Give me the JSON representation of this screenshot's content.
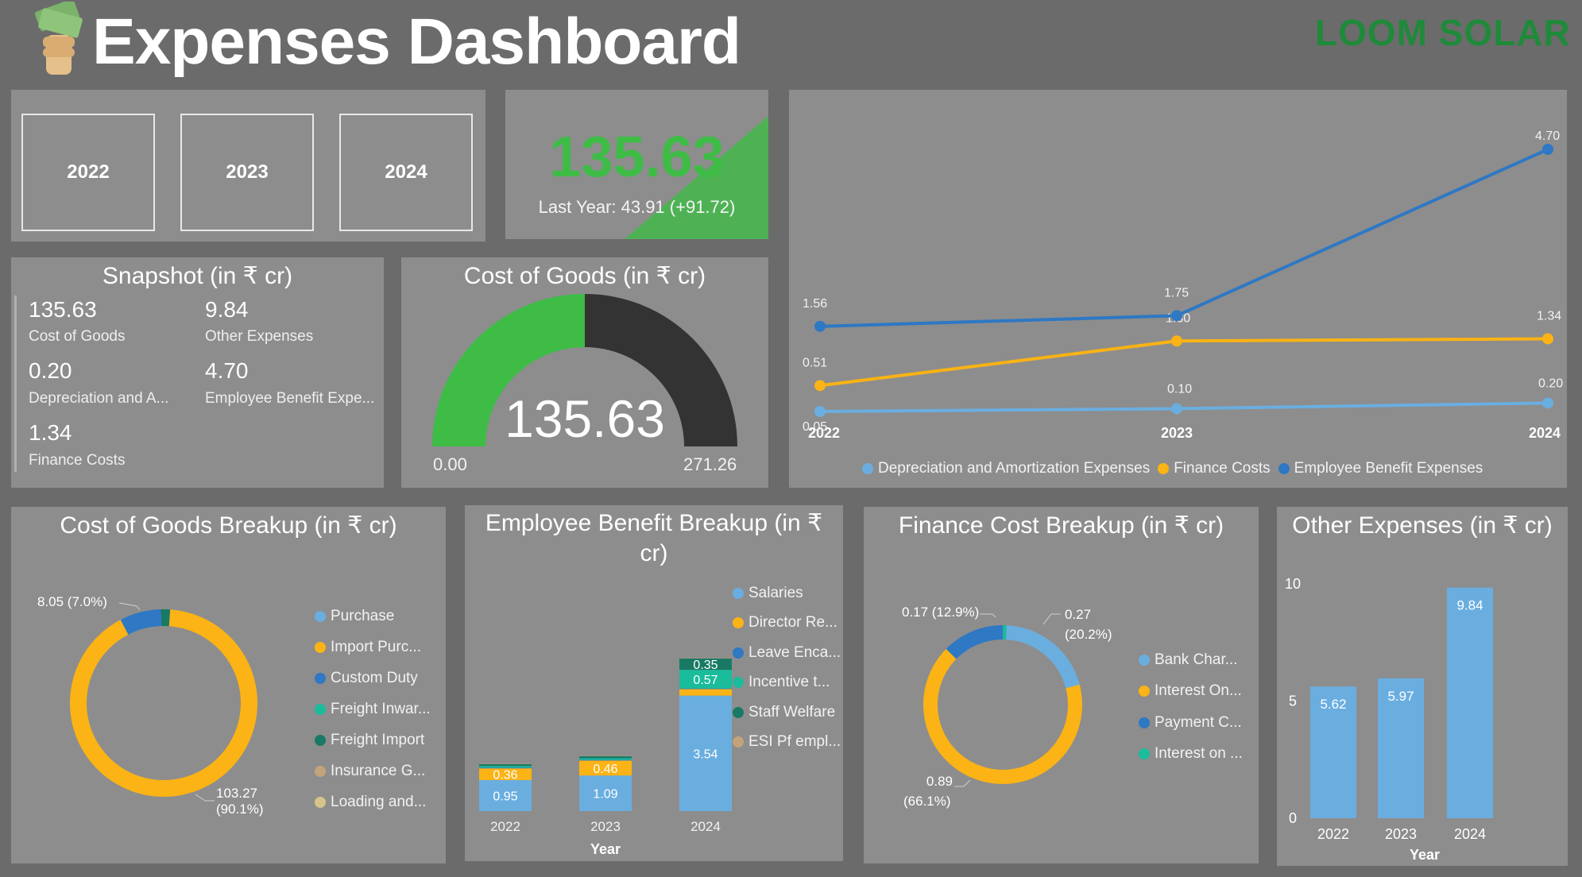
{
  "header": {
    "title": "Expenses Dashboard",
    "brand": "LOOM SOLAR"
  },
  "filters": {
    "years": [
      "2022",
      "2023",
      "2024"
    ]
  },
  "kpi": {
    "value": "135.63",
    "subtitle": "Last Year: 43.91 (+91.72)"
  },
  "colors": {
    "blue_light": "#6aaee0",
    "blue_dark": "#2e78c4",
    "orange": "#fbb315",
    "teal": "#1abc9c",
    "dark_teal": "#187a64",
    "tan": "#c3a37a",
    "gauge_green": "#3ebc46",
    "gauge_dark": "#333333",
    "kpi_green": "#3ebc46"
  },
  "snapshot": {
    "title": "Snapshot (in ₹ cr)",
    "items": [
      {
        "value": "135.63",
        "label": "Cost of Goods"
      },
      {
        "value": "9.84",
        "label": "Other Expenses"
      },
      {
        "value": "0.20",
        "label": "Depreciation and A..."
      },
      {
        "value": "4.70",
        "label": "Employee Benefit Expe..."
      },
      {
        "value": "1.34",
        "label": "Finance Costs"
      }
    ]
  },
  "chart_data": [
    {
      "id": "gauge",
      "type": "gauge",
      "title": "Cost of Goods (in ₹ cr)",
      "value": 135.63,
      "min": 0,
      "max": 271.26,
      "value_label": "135.63",
      "min_label": "0.00",
      "max_label": "271.26"
    },
    {
      "id": "trend",
      "type": "line",
      "title": "",
      "x": [
        "2022",
        "2023",
        "2024"
      ],
      "series": [
        {
          "name": "Depreciation and Amortization Expenses",
          "color": "#6aaee0",
          "values": [
            0.05,
            0.1,
            0.2
          ],
          "labels": [
            "0.05",
            "0.10",
            "0.20"
          ]
        },
        {
          "name": "Finance Costs",
          "color": "#fbb315",
          "values": [
            0.51,
            1.3,
            1.34
          ],
          "labels": [
            "0.51",
            "1.30",
            "1.34"
          ]
        },
        {
          "name": "Employee Benefit Expenses",
          "color": "#2e78c4",
          "values": [
            1.56,
            1.75,
            4.7
          ],
          "labels": [
            "1.56",
            "1.75",
            "4.70"
          ]
        }
      ]
    },
    {
      "id": "cog_breakup",
      "type": "pie",
      "title": "Cost of Goods Breakup (in ₹ cr)",
      "legend": [
        {
          "name": "Purchase",
          "color": "#6aaee0"
        },
        {
          "name": "Import Purc...",
          "color": "#fbb315"
        },
        {
          "name": "Custom Duty",
          "color": "#2e78c4"
        },
        {
          "name": "Freight Inwar...",
          "color": "#1abc9c"
        },
        {
          "name": "Freight Import",
          "color": "#187a64"
        },
        {
          "name": "Insurance G...",
          "color": "#c3a37a"
        },
        {
          "name": "Loading and...",
          "color": "#d7c48a"
        }
      ],
      "slices": [
        {
          "name": "Import Purc...",
          "value": 103.27,
          "color": "#fbb315"
        },
        {
          "name": "Custom Duty",
          "value": 8.05,
          "color": "#2e78c4"
        },
        {
          "name": "Freight Import",
          "value": 1.8,
          "color": "#187a64"
        }
      ],
      "labels": {
        "large": [
          "103.27",
          "(90.1%)"
        ],
        "small": "8.05 (7.0%)"
      }
    },
    {
      "id": "emp_breakup",
      "type": "bar",
      "title_lines": [
        "Employee Benefit Breakup (in ₹",
        "cr)"
      ],
      "xlabel": "Year",
      "categories": [
        "2022",
        "2023",
        "2024"
      ],
      "series": [
        {
          "name": "Salaries",
          "color": "#6aaee0",
          "values": [
            0.95,
            1.09,
            3.54
          ],
          "labels": [
            "0.95",
            "1.09",
            "3.54"
          ]
        },
        {
          "name": "Director Re...",
          "color": "#fbb315",
          "values": [
            0.36,
            0.46,
            0.2
          ],
          "labels": [
            "0.36",
            "0.46",
            ""
          ]
        },
        {
          "name": "Leave Enca...",
          "color": "#2e78c4",
          "values": [
            0.02,
            0.02,
            0.02
          ],
          "labels": [
            "",
            "",
            ""
          ]
        },
        {
          "name": "Incentive t...",
          "color": "#1abc9c",
          "values": [
            0.05,
            0.05,
            0.57
          ],
          "labels": [
            "",
            "",
            "0.57"
          ]
        },
        {
          "name": "Staff Welfare",
          "color": "#187a64",
          "values": [
            0.06,
            0.06,
            0.35
          ],
          "labels": [
            "",
            "",
            "0.35"
          ]
        },
        {
          "name": "ESI Pf empl...",
          "color": "#c3a37a",
          "values": [
            0.01,
            0.01,
            0.01
          ],
          "labels": [
            "",
            "",
            ""
          ]
        }
      ]
    },
    {
      "id": "fin_breakup",
      "type": "pie",
      "title": "Finance Cost Breakup (in ₹ cr)",
      "legend": [
        {
          "name": "Bank Char...",
          "color": "#6aaee0"
        },
        {
          "name": "Interest On...",
          "color": "#fbb315"
        },
        {
          "name": "Payment C...",
          "color": "#2e78c4"
        },
        {
          "name": "Interest on ...",
          "color": "#1abc9c"
        }
      ],
      "slices": [
        {
          "name": "Bank Char...",
          "value": 0.27,
          "color": "#6aaee0"
        },
        {
          "name": "Interest On...",
          "value": 0.89,
          "color": "#fbb315"
        },
        {
          "name": "Payment C...",
          "value": 0.17,
          "color": "#2e78c4"
        },
        {
          "name": "Interest on ...",
          "value": 0.01,
          "color": "#1abc9c"
        }
      ],
      "labels": {
        "a": "0.17 (12.9%)",
        "b": [
          "0.27",
          "(20.2%)"
        ],
        "c": [
          "0.89",
          "(66.1%)"
        ]
      }
    },
    {
      "id": "other_exp",
      "type": "bar",
      "title": "Other Expenses (in ₹ cr)",
      "xlabel": "Year",
      "categories": [
        "2022",
        "2023",
        "2024"
      ],
      "values": [
        5.62,
        5.97,
        9.84
      ],
      "labels": [
        "5.62",
        "5.97",
        "9.84"
      ],
      "yticks": [
        "0",
        "5",
        "10"
      ],
      "ylim": [
        0,
        10
      ]
    }
  ]
}
